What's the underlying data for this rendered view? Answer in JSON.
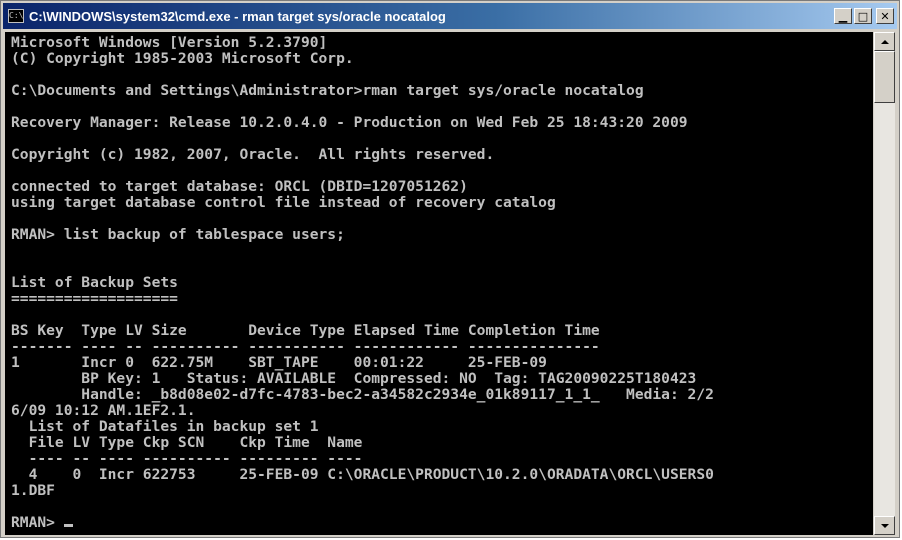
{
  "window": {
    "title": "C:\\WINDOWS\\system32\\cmd.exe - rman target sys/oracle nocatalog",
    "icon": "cmd-icon",
    "controls": {
      "minimize": "▁",
      "maximize": "□",
      "close": "✕"
    }
  },
  "console": {
    "lines": [
      "Microsoft Windows [Version 5.2.3790]",
      "(C) Copyright 1985-2003 Microsoft Corp.",
      "",
      "C:\\Documents and Settings\\Administrator>rman target sys/oracle nocatalog",
      "",
      "Recovery Manager: Release 10.2.0.4.0 - Production on Wed Feb 25 18:43:20 2009",
      "",
      "Copyright (c) 1982, 2007, Oracle.  All rights reserved.",
      "",
      "connected to target database: ORCL (DBID=1207051262)",
      "using target database control file instead of recovery catalog",
      "",
      "RMAN> list backup of tablespace users;",
      "",
      "",
      "List of Backup Sets",
      "===================",
      "",
      "BS Key  Type LV Size       Device Type Elapsed Time Completion Time",
      "------- ---- -- ---------- ----------- ------------ ---------------",
      "1       Incr 0  622.75M    SBT_TAPE    00:01:22     25-FEB-09",
      "        BP Key: 1   Status: AVAILABLE  Compressed: NO  Tag: TAG20090225T180423",
      "        Handle: _b8d08e02-d7fc-4783-bec2-a34582c2934e_01k89117_1_1_   Media: 2/2",
      "6/09 10:12 AM.1EF2.1.",
      "  List of Datafiles in backup set 1",
      "  File LV Type Ckp SCN    Ckp Time  Name",
      "  ---- -- ---- ---------- --------- ----",
      "  4    0  Incr 622753     25-FEB-09 C:\\ORACLE\\PRODUCT\\10.2.0\\ORADATA\\ORCL\\USERS0",
      "1.DBF",
      "",
      "RMAN> "
    ]
  },
  "scrollbar": {
    "up": "scroll-up",
    "down": "scroll-down"
  }
}
